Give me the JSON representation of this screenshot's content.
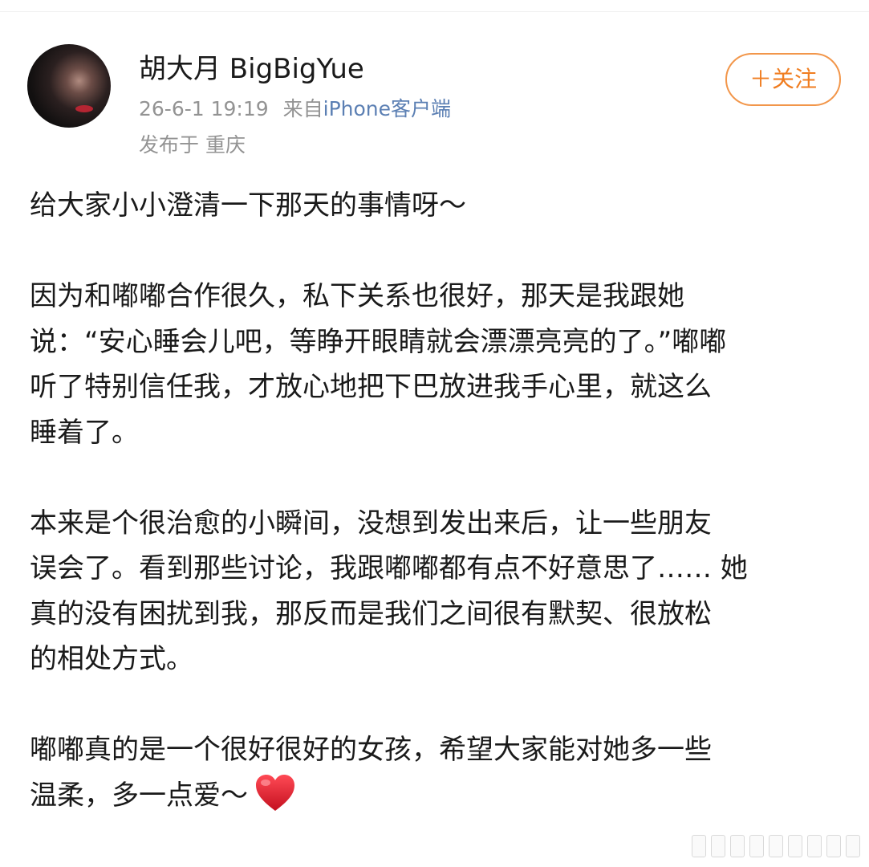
{
  "post": {
    "author": {
      "name": "胡大月 BigBigYue"
    },
    "timestamp": "26-6-1 19:19",
    "source_prefix": "来自",
    "source_client": "iPhone客户端",
    "location": "发布于 重庆",
    "follow_label": "＋关注",
    "body": {
      "p1": [
        "给大家小小澄清一下那天的事情呀～"
      ],
      "p2": [
        "因为和嘟嘟合作很久，私下关系也很好，那天是我跟她",
        "说：“安心睡会儿吧，等睁开眼睛就会漂漂亮亮的了。”嘟嘟",
        "听了特别信任我，才放心地把下巴放进我手心里，就这么",
        "睡着了。"
      ],
      "p3": [
        "本来是个很治愈的小瞬间，没想到发出来后，让一些朋友",
        "误会了。看到那些讨论，我跟嘟嘟都有点不好意思了…… 她",
        "真的没有困扰到我，那反而是我们之间很有默契、很放松",
        "的相处方式。"
      ],
      "p4": [
        "嘟嘟真的是一个很好很好的女孩，希望大家能对她多一些",
        "温柔，多一点爱～"
      ]
    },
    "emoji": "red-heart-icon"
  },
  "colors": {
    "accent_orange": "#f07d20",
    "link_blue": "#5b7fb3",
    "meta_gray": "#939393",
    "heart_red": "#e0202f"
  }
}
